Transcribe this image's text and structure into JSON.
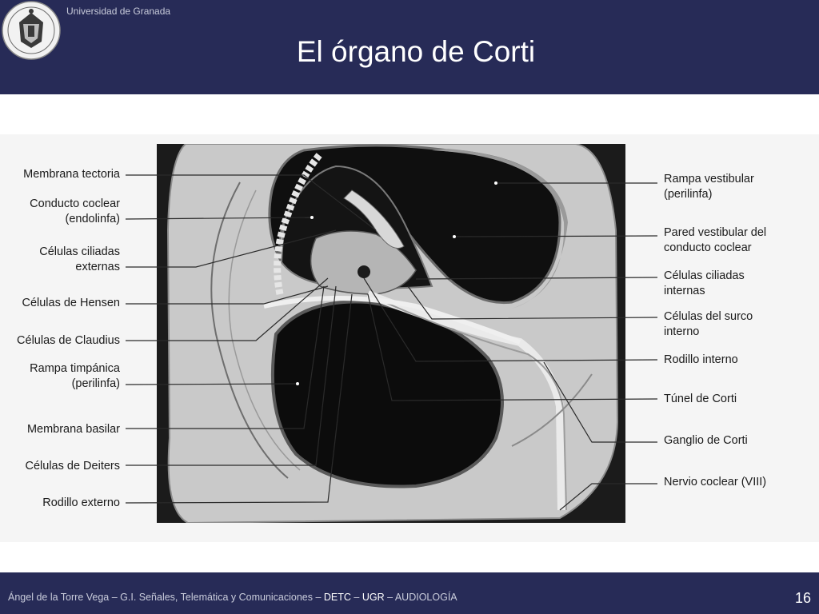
{
  "header": {
    "university": "Universidad de Granada",
    "title": "El órgano de Corti",
    "logo_icon": "university-seal-icon"
  },
  "labels_left": [
    "Membrana tectoria",
    "Conducto coclear (endolinfa)",
    "Células ciliadas externas",
    "Células de Hensen",
    "Células de Claudius",
    "Rampa timpánica (perilinfa)",
    "Membrana basilar",
    "Células de Deiters",
    "Rodillo externo"
  ],
  "labels_right": [
    "Rampa vestibular (perilinfa)",
    "Pared vestibular del conducto coclear",
    "Células ciliadas internas",
    "Células del surco interno",
    "Rodillo interno",
    "Túnel de Corti",
    "Ganglio de Corti",
    "Nervio coclear (VIII)"
  ],
  "footer": {
    "author": "Ángel de la Torre Vega – G.I. Señales, Telemática y Comunicaciones – ",
    "detc": "DETC",
    "sep1": " – ",
    "ugr": "UGR",
    "sep2": " – ",
    "course": "AUDIOLOGÍA",
    "page": "16"
  },
  "colors": {
    "bar": "#272b57",
    "panel": "#1b1b1b",
    "tissue": "#c9c9c9"
  }
}
